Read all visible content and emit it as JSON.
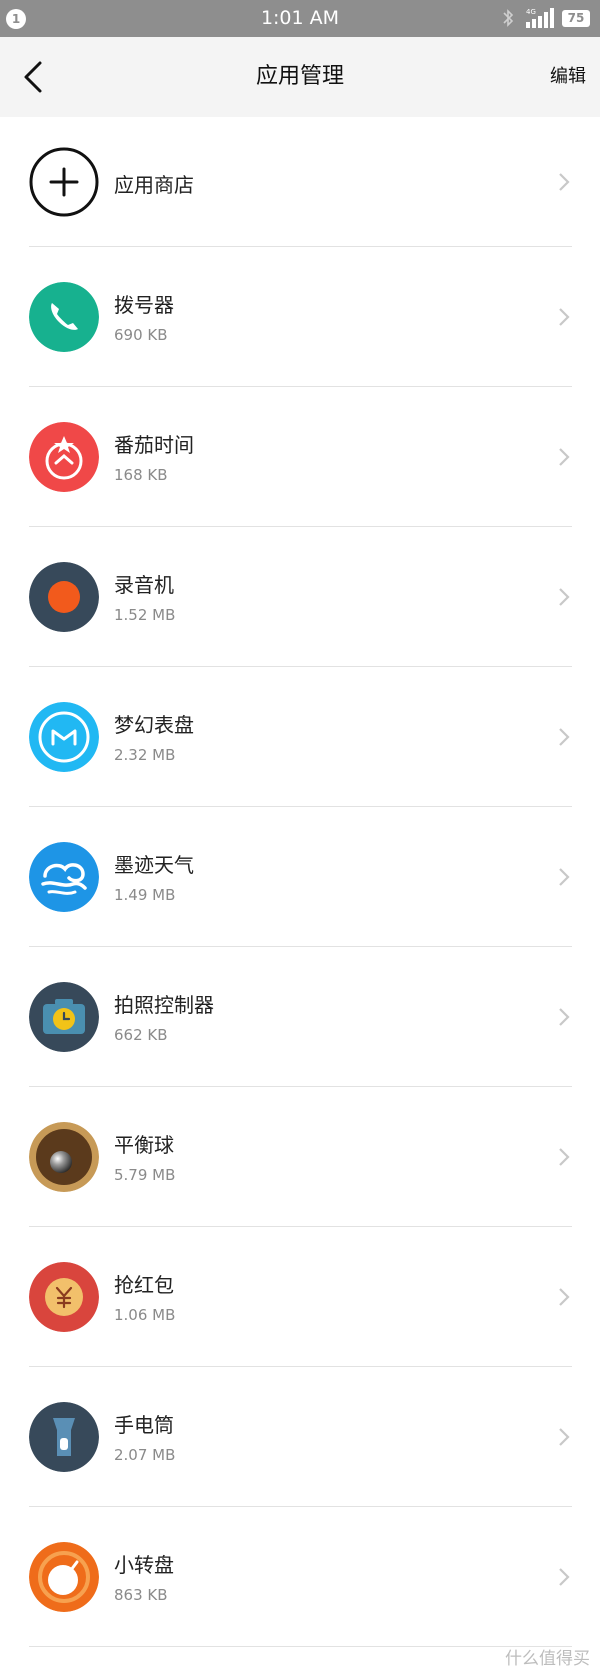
{
  "status_bar": {
    "notification_count": "1",
    "time": "1:01 AM",
    "network_label": "4G",
    "battery": "75",
    "icons": [
      "bluetooth-icon",
      "signal-icon",
      "battery-icon"
    ]
  },
  "header": {
    "title": "应用管理",
    "edit_label": "编辑",
    "back_icon": "back-arrow-icon"
  },
  "apps": [
    {
      "name": "应用商店",
      "size": "",
      "icon": "add-circle-icon"
    },
    {
      "name": "拨号器",
      "size": "690 KB",
      "icon": "phone-icon",
      "color": "#17b18f"
    },
    {
      "name": "番茄时间",
      "size": "168 KB",
      "icon": "tomato-timer-icon",
      "color": "#f04848"
    },
    {
      "name": "录音机",
      "size": "1.52 MB",
      "icon": "recorder-icon",
      "color": "#37495a"
    },
    {
      "name": "梦幻表盘",
      "size": "2.32 MB",
      "icon": "watchface-icon",
      "color": "#21b8f3"
    },
    {
      "name": "墨迹天气",
      "size": "1.49 MB",
      "icon": "weather-icon",
      "color": "#1e95e6"
    },
    {
      "name": "拍照控制器",
      "size": "662 KB",
      "icon": "camera-timer-icon",
      "color": "#37495a"
    },
    {
      "name": "平衡球",
      "size": "5.79 MB",
      "icon": "balance-ball-icon",
      "color": "#b88c4a"
    },
    {
      "name": "抢红包",
      "size": "1.06 MB",
      "icon": "red-envelope-icon",
      "color": "#d9453d"
    },
    {
      "name": "手电筒",
      "size": "2.07 MB",
      "icon": "flashlight-icon",
      "color": "#37495a"
    },
    {
      "name": "小转盘",
      "size": "863 KB",
      "icon": "spinner-icon",
      "color": "#ef6c1a"
    }
  ],
  "watermark": "什么值得买"
}
